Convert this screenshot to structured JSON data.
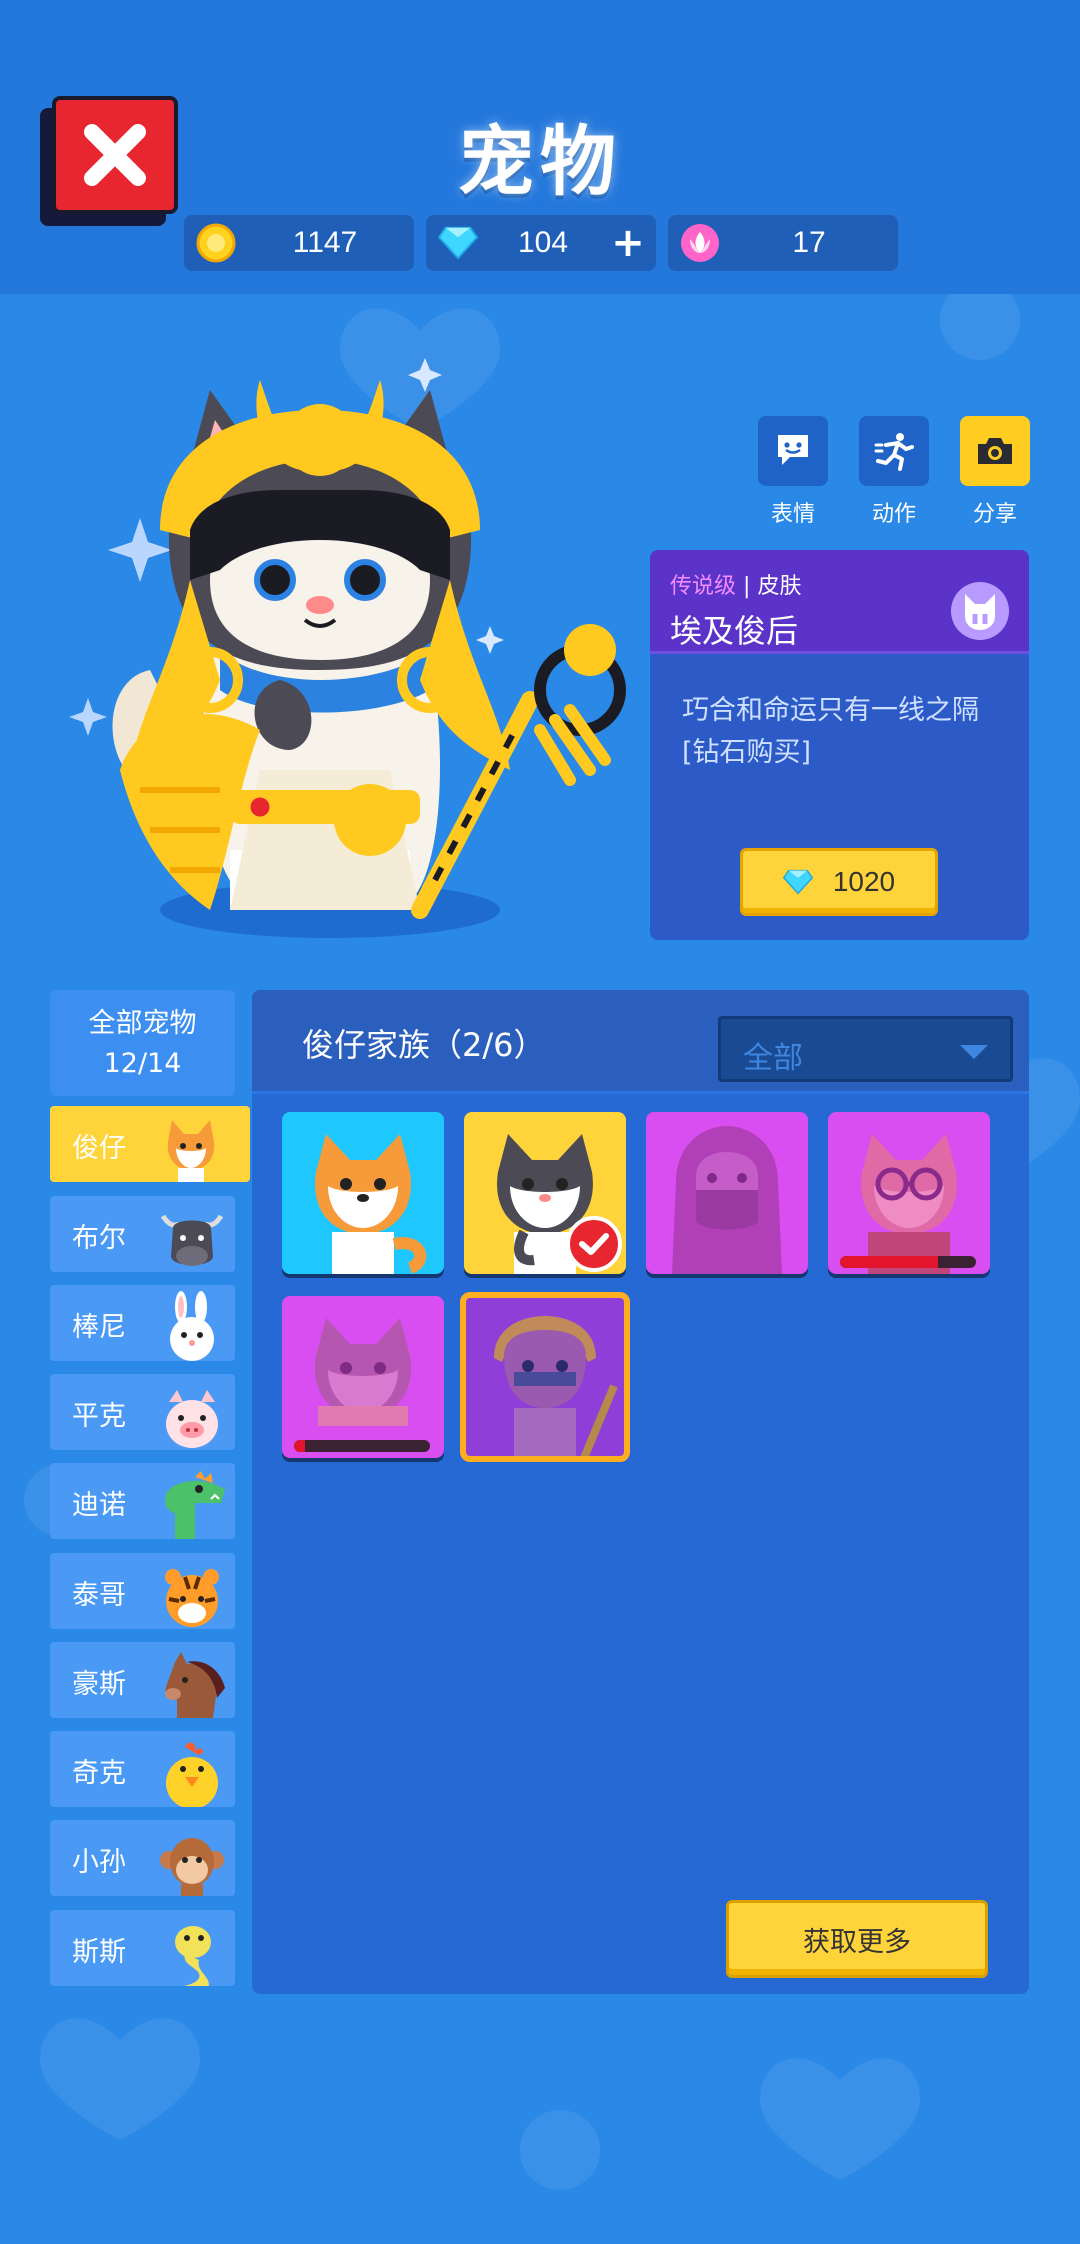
{
  "header": {
    "title": "宠物",
    "currencies": [
      {
        "icon": "gold-coin-icon",
        "value": "1147"
      },
      {
        "icon": "diamond-icon",
        "value": "104",
        "plus": "+"
      },
      {
        "icon": "lotus-icon",
        "value": "17"
      }
    ]
  },
  "actions": [
    {
      "icon": "emote-icon",
      "label": "表情"
    },
    {
      "icon": "action-icon",
      "label": "动作"
    },
    {
      "icon": "camera-icon",
      "label": "分享"
    }
  ],
  "skin": {
    "rarity": "传说级",
    "separator": "|",
    "type": "皮肤",
    "name": "埃及俊后",
    "description_line1": "巧合和命运只有一线之隔",
    "description_line2": "[钻石购买]",
    "price": "1020",
    "price_icon": "diamond-icon"
  },
  "sidebar": {
    "all_label": "全部宠物",
    "all_count": "12/14",
    "items": [
      {
        "label": "俊仔",
        "pet": "shiba",
        "active": true
      },
      {
        "label": "布尔",
        "pet": "bull"
      },
      {
        "label": "棒尼",
        "pet": "bunny"
      },
      {
        "label": "平克",
        "pet": "pig"
      },
      {
        "label": "迪诺",
        "pet": "dino"
      },
      {
        "label": "泰哥",
        "pet": "tiger"
      },
      {
        "label": "豪斯",
        "pet": "horse"
      },
      {
        "label": "奇克",
        "pet": "chick"
      },
      {
        "label": "小孙",
        "pet": "monkey"
      },
      {
        "label": "斯斯",
        "pet": "snake"
      }
    ]
  },
  "family": {
    "title": "俊仔家族（2/6）",
    "filter": "全部",
    "cards": [
      {
        "name": "shiba-default",
        "owned": true,
        "progress": null
      },
      {
        "name": "shiba-black",
        "owned": true,
        "equipped": true,
        "progress": null
      },
      {
        "name": "shiba-hood",
        "owned": false,
        "progress": null
      },
      {
        "name": "shiba-glasses",
        "owned": false,
        "progress": 0.72
      },
      {
        "name": "shiba-scarf",
        "owned": false,
        "progress": 0.08
      },
      {
        "name": "shiba-egypt",
        "owned": false,
        "selected": true,
        "progress": null
      }
    ],
    "more_label": "获取更多"
  },
  "colors": {
    "background": "#2a88e6",
    "accent_yellow": "#ffd33a",
    "close_red": "#e8262f",
    "legendary_purple": "#5b33c9"
  }
}
